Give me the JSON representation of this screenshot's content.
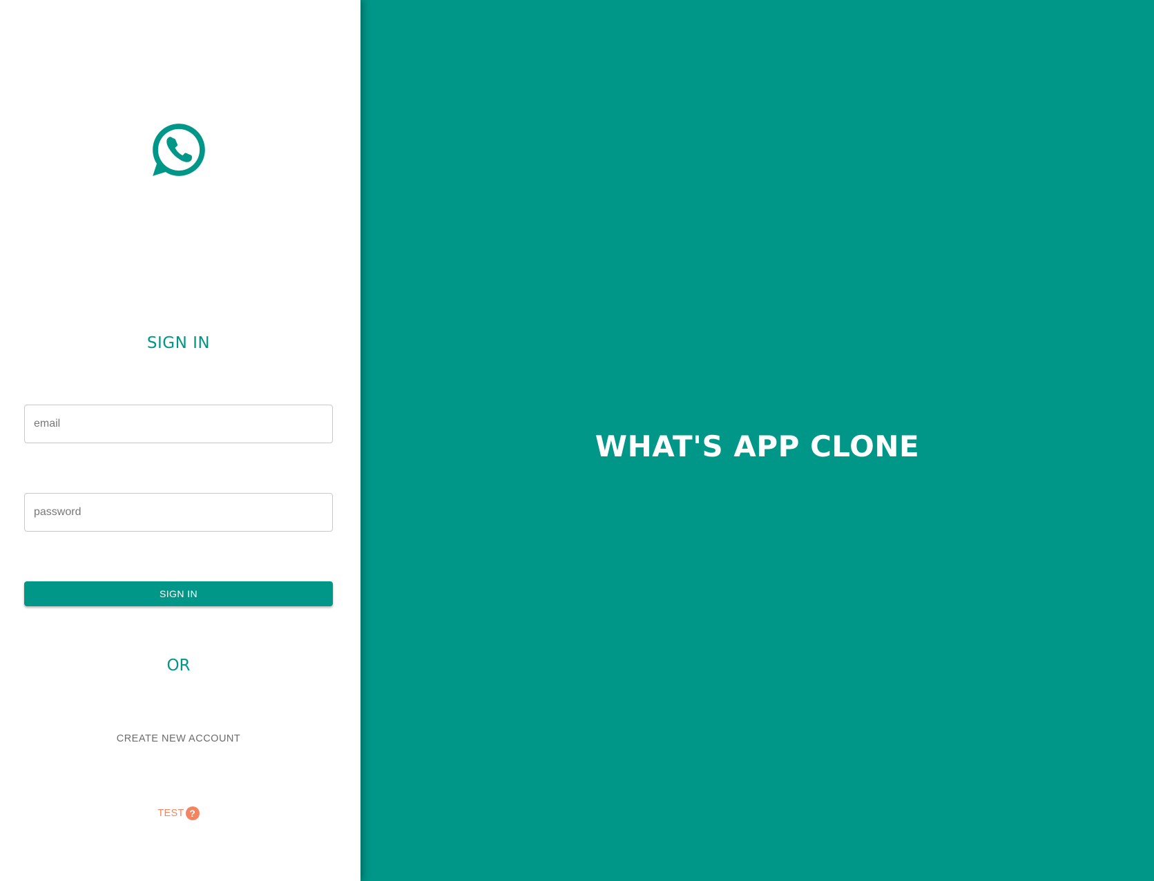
{
  "colors": {
    "accent": "#009688",
    "panel_background": "#ffffff",
    "test_link": "#f4845f"
  },
  "logo": {
    "icon": "whatsapp-icon"
  },
  "sign_in_form": {
    "heading": "SIGN IN",
    "email": {
      "value": "",
      "placeholder": "email"
    },
    "password": {
      "value": "",
      "placeholder": "password"
    },
    "submit_label": "SIGN IN",
    "divider_text": "OR",
    "create_account_label": "CREATE NEW ACCOUNT",
    "test_label": "TEST",
    "help_icon": {
      "name": "help-circle-icon",
      "glyph": "?"
    }
  },
  "hero": {
    "title": "WHAT'S APP CLONE"
  }
}
